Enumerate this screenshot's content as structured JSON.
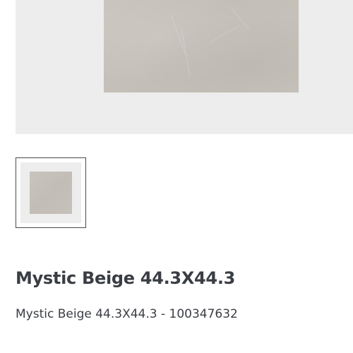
{
  "gallery": {
    "main_image_alt": "Mystic Beige tile",
    "thumbnails": [
      {
        "alt": "Mystic Beige tile thumbnail",
        "selected": true
      }
    ]
  },
  "product": {
    "title": "Mystic Beige 44.3X44.3",
    "subtitle": "Mystic Beige 44.3X44.3 - 100347632"
  },
  "colors": {
    "gallery_background": "#eeeded",
    "tile": "#c6c1ba",
    "text": "#3a3d44",
    "thumbnail_border": "#4a4a4a"
  }
}
